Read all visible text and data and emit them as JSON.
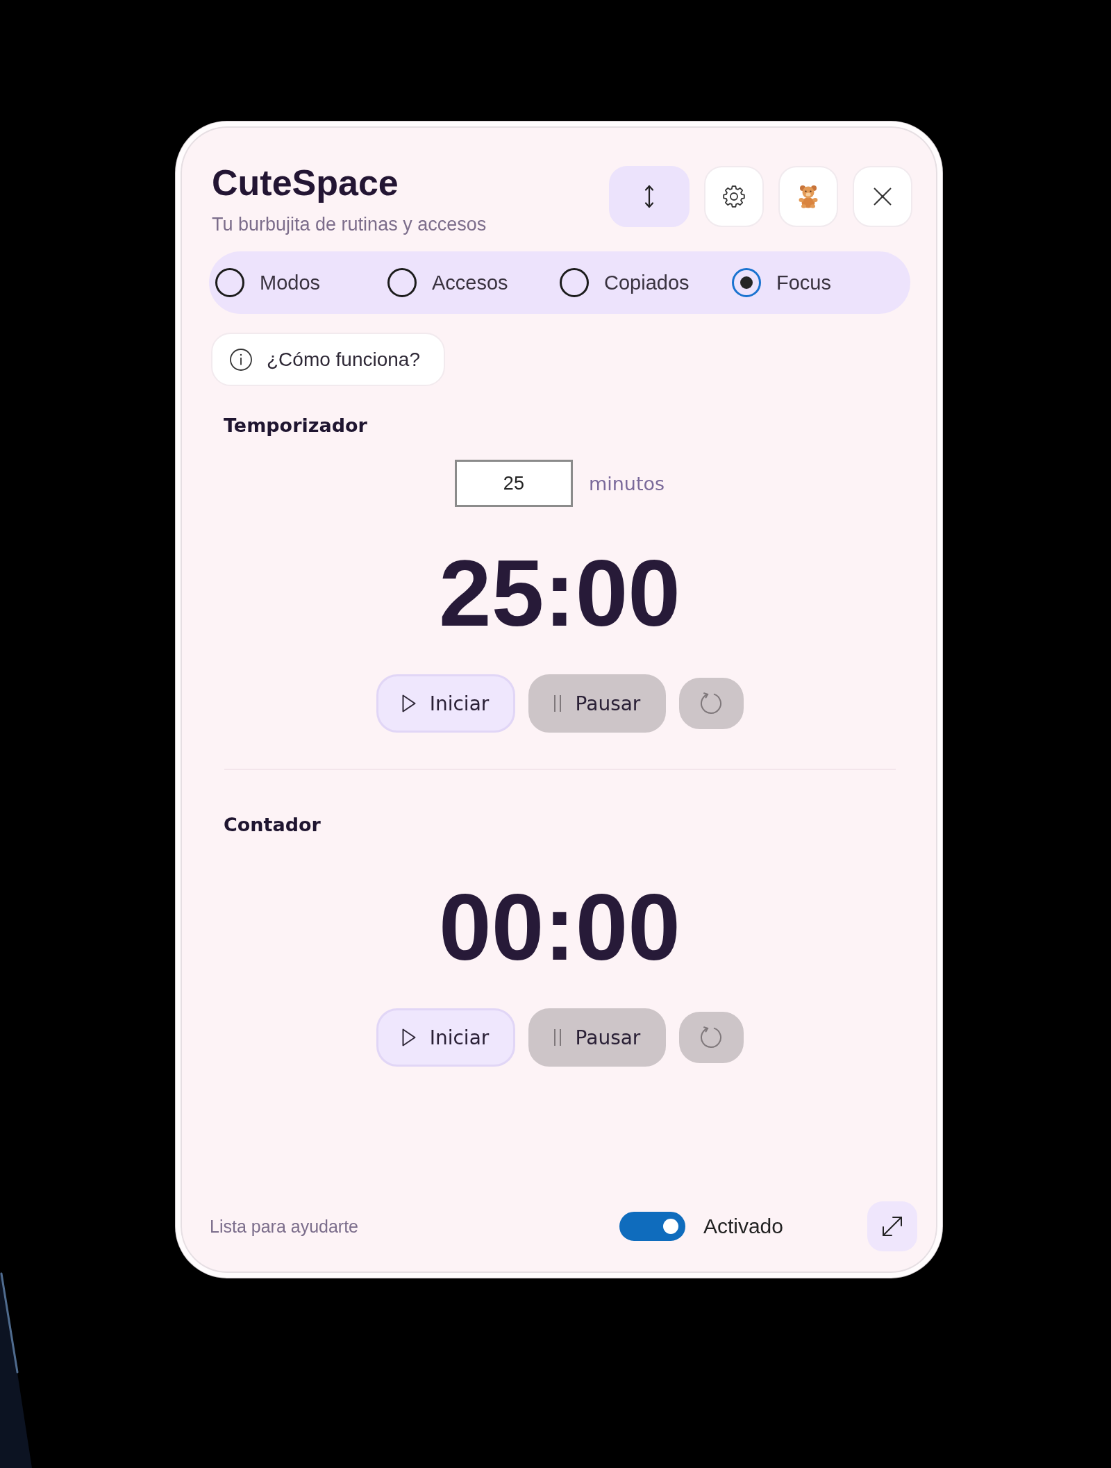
{
  "header": {
    "title": "CuteSpace",
    "subtitle": "Tu burbujita de rutinas y accesos",
    "buttons": [
      {
        "kind": "resize",
        "active": true
      },
      {
        "kind": "settings",
        "active": false
      },
      {
        "kind": "mascot",
        "active": false
      },
      {
        "kind": "close",
        "active": false
      }
    ]
  },
  "tabs": [
    {
      "label": "Modos",
      "selected": false
    },
    {
      "label": "Accesos",
      "selected": false
    },
    {
      "label": "Copiados",
      "selected": false
    },
    {
      "label": "Focus",
      "selected": true
    }
  ],
  "help_button": {
    "label": "¿Cómo funciona?"
  },
  "sections": [
    {
      "title": "Temporizador",
      "minutes_field": {
        "value": "25",
        "unit": "minutos"
      },
      "display": "25:00",
      "controls": [
        {
          "kind": "start",
          "label": "Iniciar",
          "disabled": false
        },
        {
          "kind": "pause",
          "label": "Pausar",
          "disabled": true
        },
        {
          "kind": "reset",
          "disabled": true
        }
      ]
    },
    {
      "title": "Contador",
      "display": "00:00",
      "controls": [
        {
          "kind": "start",
          "label": "Iniciar",
          "disabled": false
        },
        {
          "kind": "pause",
          "label": "Pausar",
          "disabled": true
        },
        {
          "kind": "reset",
          "disabled": true
        }
      ]
    }
  ],
  "footer": {
    "status": "Lista para ayudarte",
    "toggle": {
      "on": true,
      "label": "Activado"
    }
  }
}
